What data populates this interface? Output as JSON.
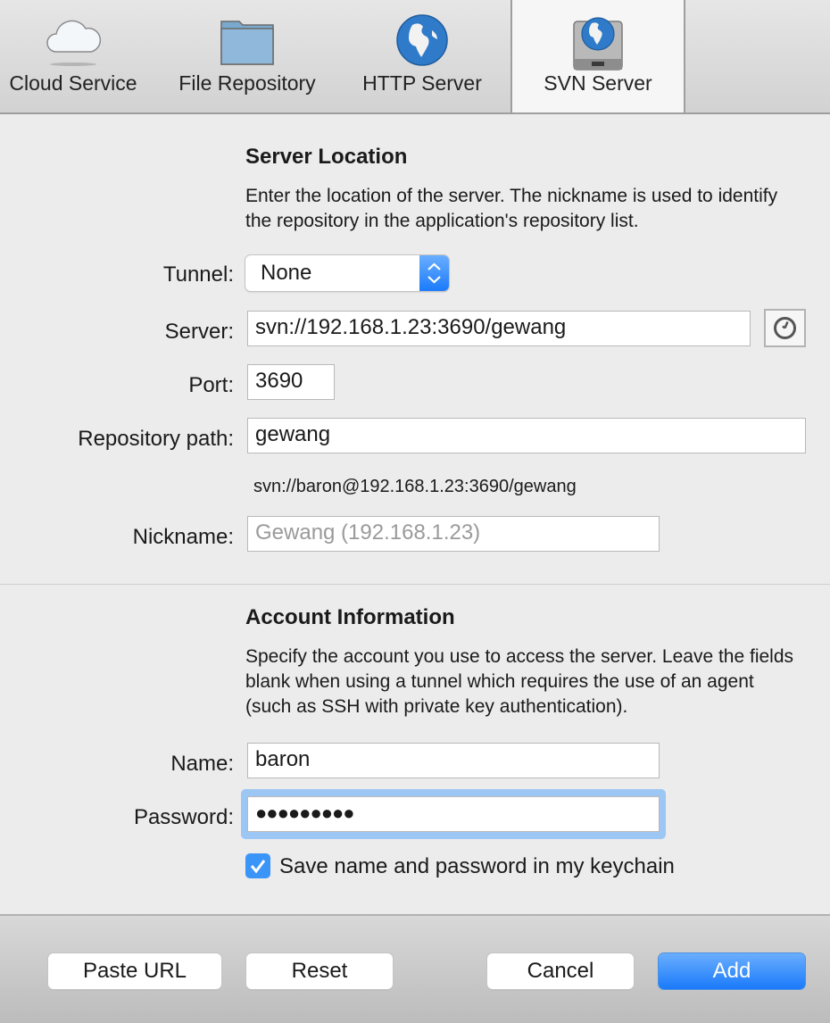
{
  "tabs": [
    {
      "label": "Cloud Service",
      "icon": "cloud-icon",
      "active": false
    },
    {
      "label": "File Repository",
      "icon": "folder-icon",
      "active": false
    },
    {
      "label": "HTTP Server",
      "icon": "globe-icon",
      "active": false
    },
    {
      "label": "SVN Server",
      "icon": "server-globe-icon",
      "active": true
    }
  ],
  "server_location": {
    "heading": "Server Location",
    "description": "Enter the location of the server. The nickname is used to identify the repository in the application's repository list.",
    "tunnel_label": "Tunnel:",
    "tunnel_value": "None",
    "server_label": "Server:",
    "server_value": "svn://192.168.1.23:3690/gewang",
    "port_label": "Port:",
    "port_value": "3690",
    "repo_label": "Repository path:",
    "repo_value": "gewang",
    "resolved_url": "svn://baron@192.168.1.23:3690/gewang",
    "nickname_label": "Nickname:",
    "nickname_placeholder": "Gewang (192.168.1.23)"
  },
  "account": {
    "heading": "Account Information",
    "description": "Specify the account you use to access the server. Leave the fields blank when using a tunnel which requires the use of an agent (such as SSH with private key authentication).",
    "name_label": "Name:",
    "name_value": "baron",
    "password_label": "Password:",
    "password_value": "●●●●●●●●●",
    "keychain_label": "Save name and password in my keychain",
    "keychain_checked": true
  },
  "footer": {
    "paste_url": "Paste URL",
    "reset": "Reset",
    "cancel": "Cancel",
    "add": "Add"
  },
  "colors": {
    "accent": "#1b7bfb",
    "focus_ring": "#9cc6f4"
  }
}
